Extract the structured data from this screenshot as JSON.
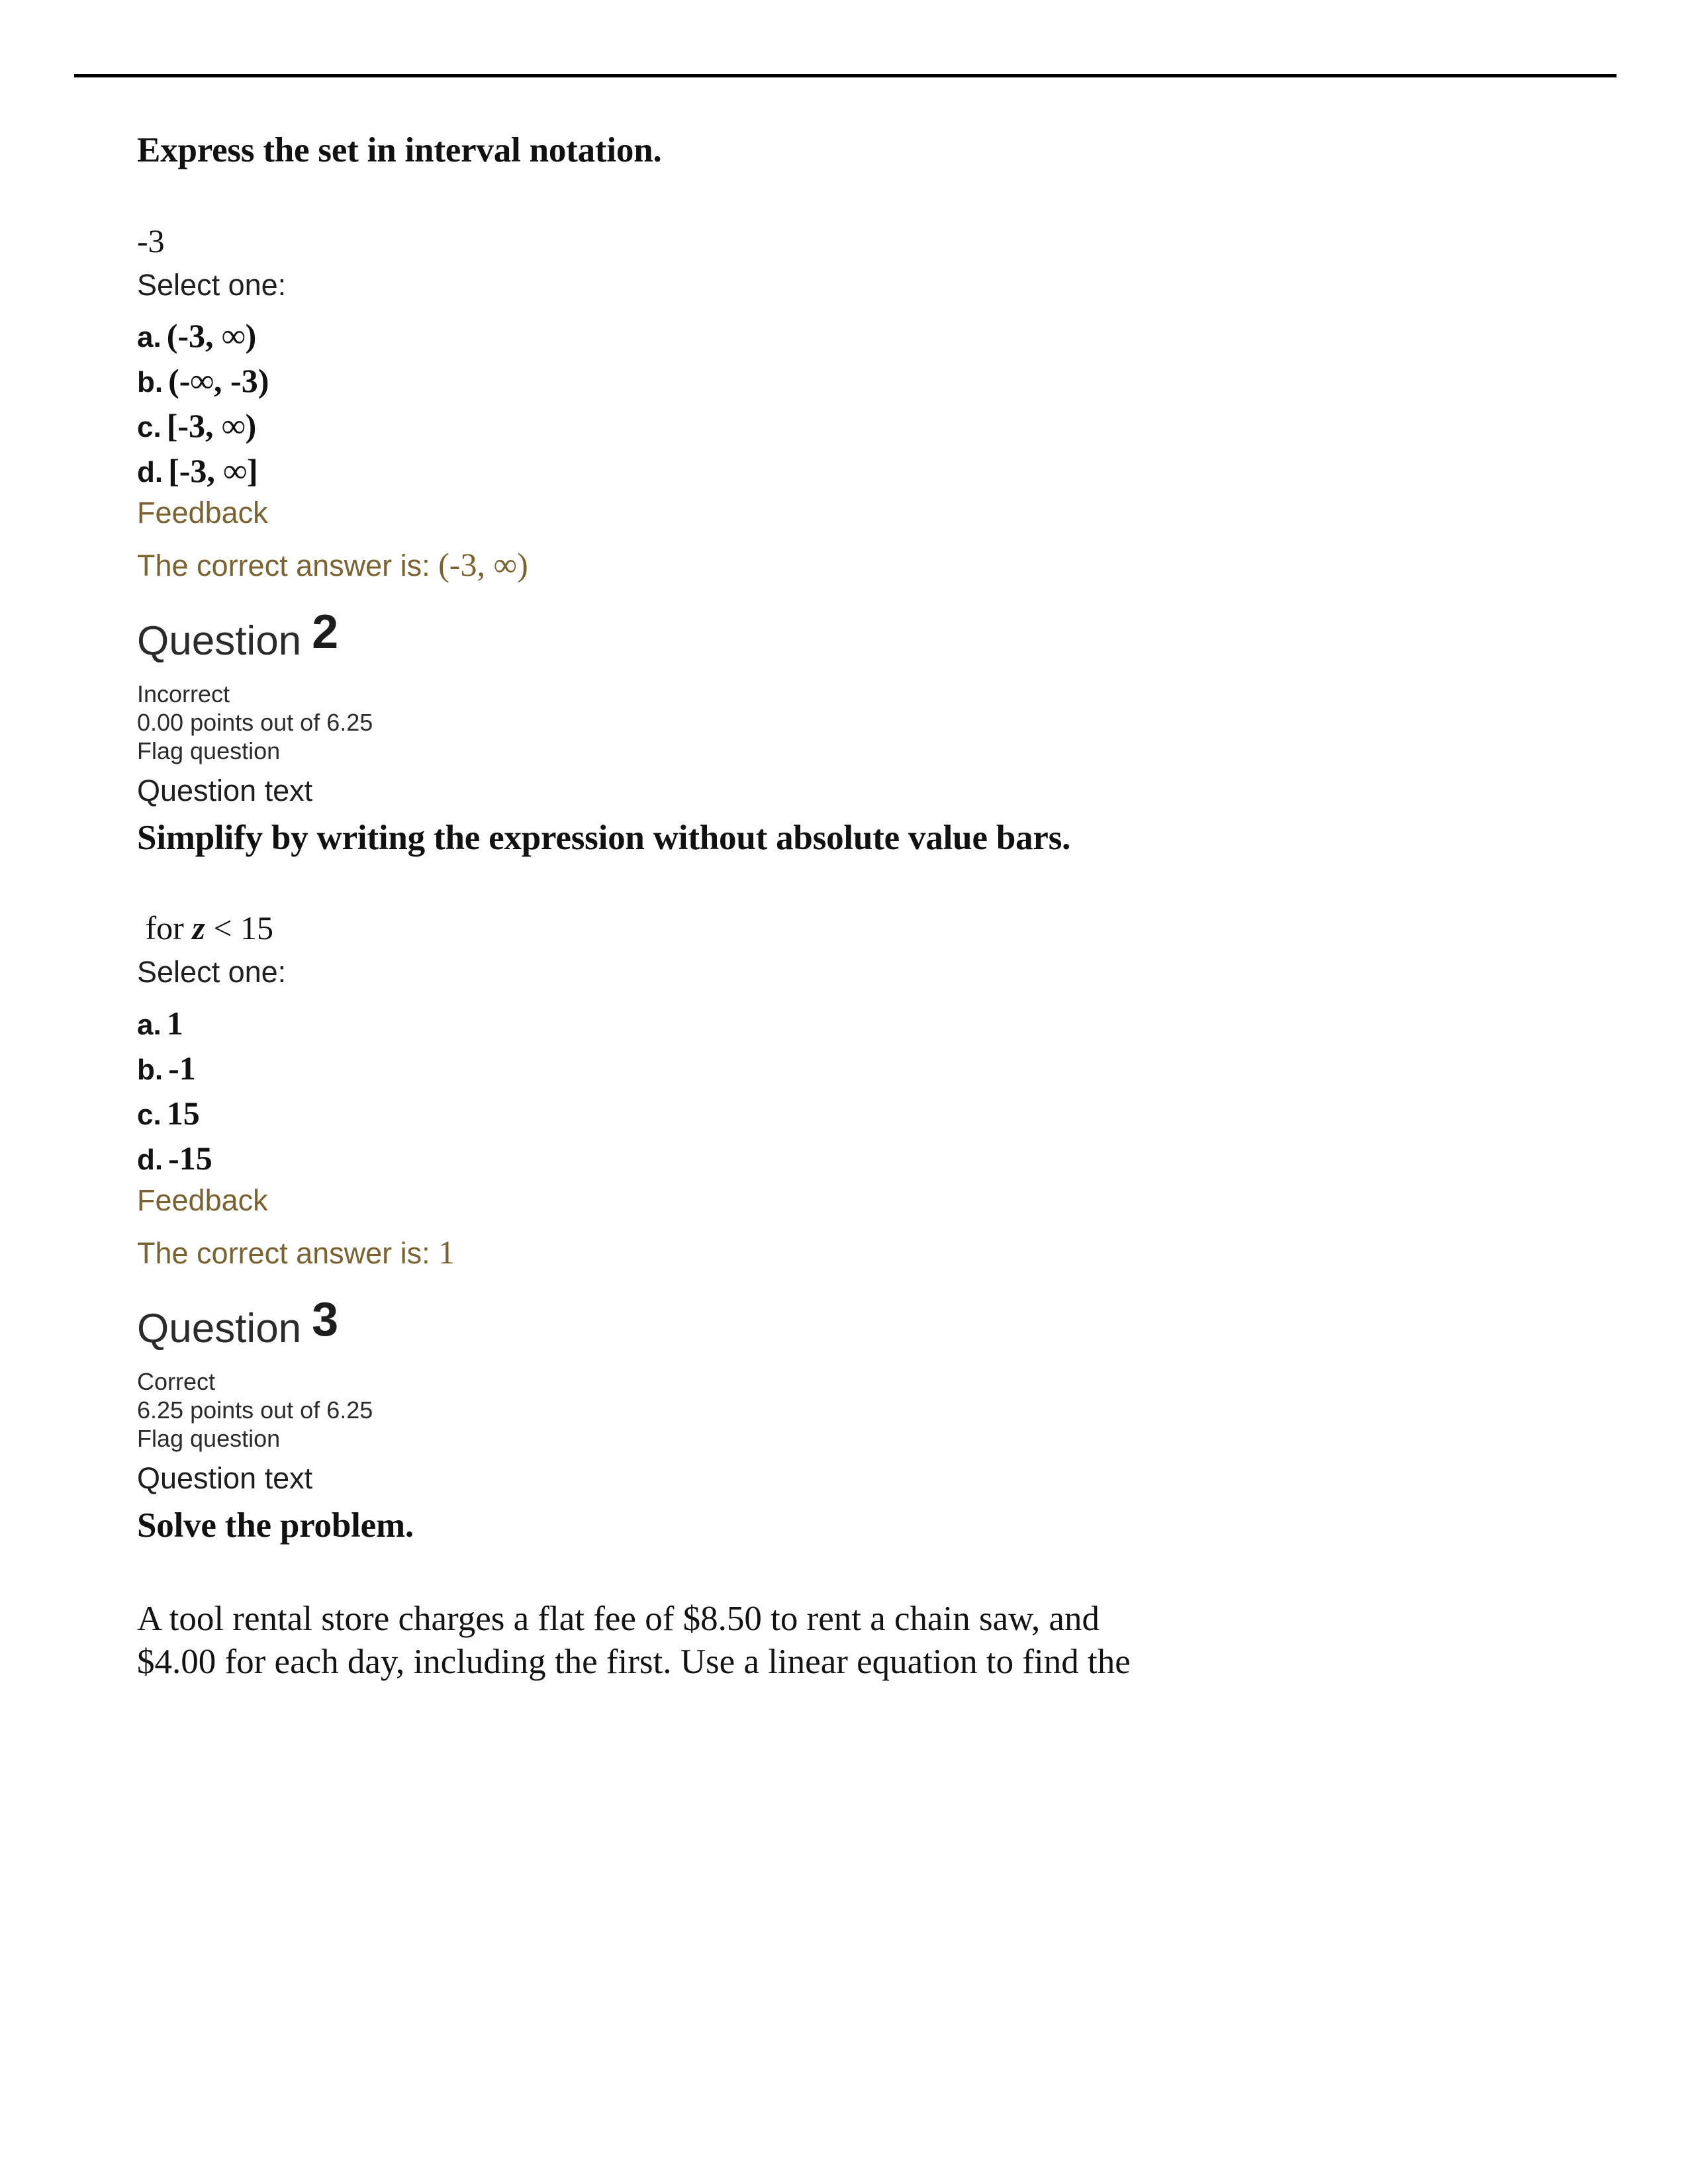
{
  "page": {
    "background": "#ffffff",
    "rule_color": "#000000",
    "feedback_color": "#7a6231",
    "text_color": "#141414"
  },
  "question1": {
    "prompt": "Express the set in interval notation.",
    "expression": "-3",
    "select_one_label": "Select one:",
    "options": [
      {
        "label": "a.",
        "value": "(-3, ∞)"
      },
      {
        "label": "b.",
        "value": "(-∞, -3)"
      },
      {
        "label": "c.",
        "value": "[-3, ∞)"
      },
      {
        "label": "d.",
        "value": "[-3, ∞]"
      }
    ],
    "feedback_label": "Feedback",
    "correct_answer_prefix": "The correct answer is:",
    "correct_answer_value": "(-3, ∞)"
  },
  "question2": {
    "title_word": "Question",
    "title_number": "2",
    "status": "Incorrect",
    "points": "0.00 points out of 6.25",
    "flag_label": "Flag question",
    "question_text_label": "Question text",
    "prompt": "Simplify by writing the expression without absolute value bars.",
    "condition_prefix": "for",
    "condition_variable": "z",
    "condition_suffix": "< 15",
    "select_one_label": "Select one:",
    "options": [
      {
        "label": "a.",
        "value": "1"
      },
      {
        "label": "b.",
        "value": "-1"
      },
      {
        "label": "c.",
        "value": "15"
      },
      {
        "label": "d.",
        "value": "-15"
      }
    ],
    "feedback_label": "Feedback",
    "correct_answer_prefix": "The correct answer is:",
    "correct_answer_value": "1"
  },
  "question3": {
    "title_word": "Question",
    "title_number": "3",
    "status": "Correct",
    "points": "6.25 points out of 6.25",
    "flag_label": "Flag question",
    "question_text_label": "Question text",
    "prompt": "Solve the problem.",
    "body_line1": "A tool rental store charges a flat fee of $8.50 to rent a chain saw, and",
    "body_line2": "$4.00 for each day, including the first. Use a linear equation to find the"
  }
}
